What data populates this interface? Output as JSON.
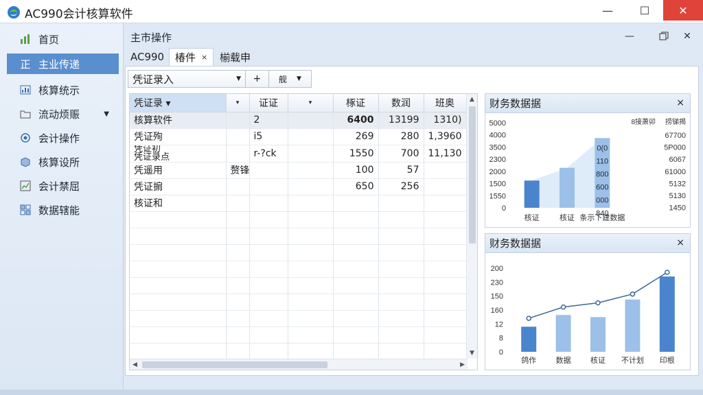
{
  "app": {
    "title": "AC990会计核算软件"
  },
  "window_controls": {
    "minimize": "—",
    "maximize": "☐",
    "close": "✕"
  },
  "sidebar": {
    "items": [
      {
        "label": "首页",
        "icon": "bar-chart-icon"
      },
      {
        "label": "主业传递",
        "icon": "ledger-icon",
        "active": true,
        "glyph": "正"
      },
      {
        "label": "核算统示",
        "icon": "report-icon"
      },
      {
        "label": "流动烦赈",
        "icon": "folder-icon",
        "has_caret": true
      },
      {
        "label": "会计操作",
        "icon": "gear-icon"
      },
      {
        "label": "核算设所",
        "icon": "box-icon"
      },
      {
        "label": "会计禁屈",
        "icon": "chart-doc-icon"
      },
      {
        "label": "数据辖能",
        "icon": "database-icon"
      }
    ]
  },
  "main": {
    "title": "主市操作",
    "header_close": "✕"
  },
  "tabs": [
    {
      "label": "AC990"
    },
    {
      "label": "椿件",
      "active": true,
      "close": "×"
    },
    {
      "label": "椾载申"
    }
  ],
  "toolbar": {
    "select_label": "凭证录入",
    "add_label": "+",
    "btn3_label": "舰"
  },
  "grid": {
    "headers": [
      "凭证录 ▾",
      "▾",
      "证证",
      "▾",
      "椓证",
      "数润",
      "班奥"
    ],
    "rows": [
      [
        "核算软件",
        "",
        "2",
        "",
        "6400",
        "13199",
        "1310)"
      ],
      [
        "凭证殉",
        "",
        "i5",
        "",
        "269",
        "280",
        "1,3960"
      ],
      [
        "凭证初\n凭证录点",
        "",
        "r-?ck",
        "",
        "1550",
        "700",
        "11,130"
      ],
      [
        "凭遥用",
        "赘锋",
        "",
        "",
        "100",
        "57",
        ""
      ],
      [
        "凭证掮",
        "",
        "",
        "",
        "650",
        "256",
        ""
      ],
      [
        "核证和",
        "",
        "",
        "",
        "",
        "",
        ""
      ]
    ]
  },
  "panel1": {
    "title": "财务数据据",
    "close": "×"
  },
  "panel2": {
    "title": "财务数据据",
    "close": "×"
  },
  "chart_data": [
    {
      "type": "bar",
      "title": "财务数据据",
      "yticks": [
        "5000",
        "4000",
        "3500",
        "2300",
        "2000",
        "1500",
        "1550",
        "0"
      ],
      "categories": [
        "核证",
        "核证",
        "条示下建数据"
      ],
      "values": [
        1600,
        2350,
        4100
      ],
      "overlay_labels": [
        "0(0",
        "110",
        "800",
        "600",
        "000",
        "840"
      ],
      "right_header_1": "8接萧卯",
      "right_header_2": "捞锑揭",
      "right_values": [
        "67700",
        "5P000",
        "6067",
        "61000",
        "5132",
        "5130",
        "1450"
      ],
      "ylim": [
        0,
        5000
      ]
    },
    {
      "type": "bar",
      "title": "财务数据据",
      "yticks": [
        "200",
        "230",
        "150",
        "160",
        "12",
        "8",
        "0"
      ],
      "categories": [
        "鸽作",
        "数据",
        "核证",
        "不计划",
        "印根"
      ],
      "bar_values": [
        60,
        88,
        83,
        125,
        180
      ],
      "line_values": [
        80,
        107,
        117,
        138,
        190
      ],
      "ylim": [
        0,
        200
      ]
    }
  ],
  "colors": {
    "accent": "#5a8fcf",
    "bar_dark": "#4a84cc",
    "bar_light": "#9cc0e8",
    "line": "#3c6895"
  }
}
